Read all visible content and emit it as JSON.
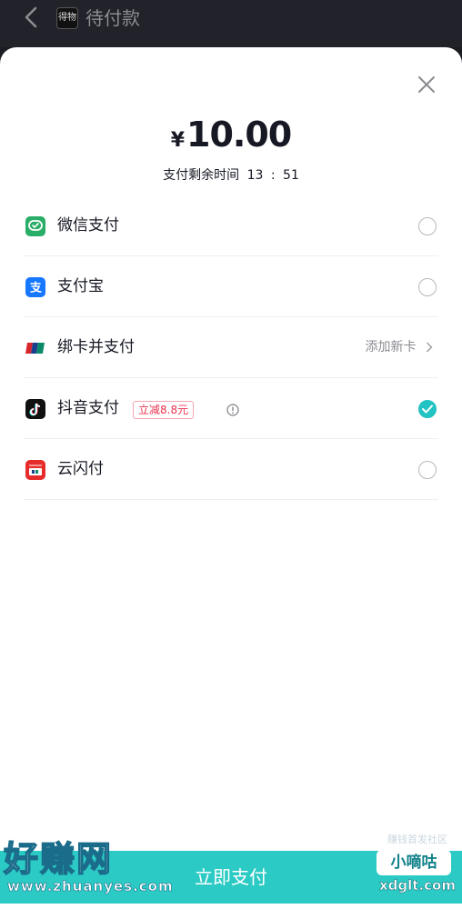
{
  "header": {
    "title": "待付款",
    "logo_text": "得物"
  },
  "amount": {
    "currency": "¥",
    "value": "10.00"
  },
  "countdown": {
    "label": "支付剩余时间",
    "minutes": "13",
    "separator": ":",
    "seconds": "51"
  },
  "methods": [
    {
      "name": "微信支付",
      "icon": "wechat-pay-icon",
      "selected": false
    },
    {
      "name": "支付宝",
      "icon": "alipay-icon",
      "selected": false
    },
    {
      "name": "绑卡并支付",
      "icon": "unionpay-icon",
      "action": "添加新卡"
    },
    {
      "name": "抖音支付",
      "icon": "douyin-pay-icon",
      "promo": "立减8.8元",
      "selected": true
    },
    {
      "name": "云闪付",
      "icon": "quickpass-icon",
      "selected": false
    }
  ],
  "pay_button": "立即支付",
  "watermarks": {
    "left_big": "好赚网",
    "left_small": "www.zhuanyes.com",
    "right_top": "赚钱首发社区",
    "right_badge": "小嘀咕",
    "right_site": "xdglt.com"
  },
  "colors": {
    "accent": "#2ccac4",
    "check": "#22c3c3",
    "promo": "#e8344e"
  }
}
